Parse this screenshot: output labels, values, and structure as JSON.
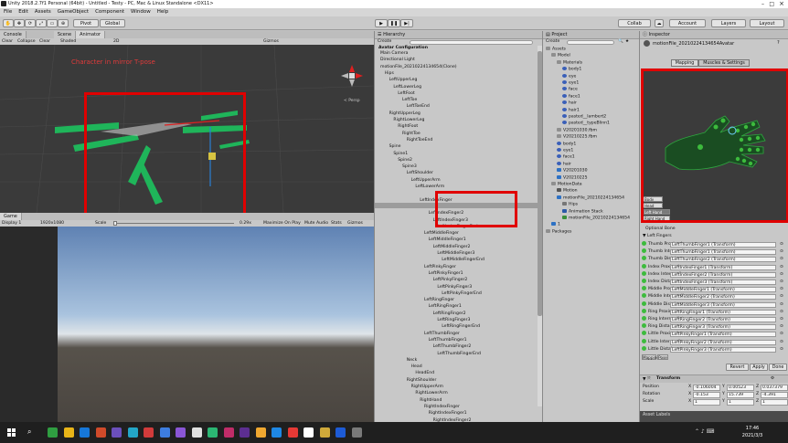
{
  "window": {
    "title": "Unity 2018.2.7f1 Personal (64bit) - Untitled - Testy - PC, Mac & Linux Standalone <DX11>"
  },
  "menu": [
    "File",
    "Edit",
    "Assets",
    "GameObject",
    "Component",
    "Window",
    "Help"
  ],
  "toolbar": {
    "pivot": "Pivot",
    "global": "Global",
    "collab": "Collab",
    "account": "Account",
    "layers": "Layers",
    "layout": "Layout"
  },
  "scene": {
    "tabs": [
      "Console",
      "Scene",
      "Animator"
    ],
    "row": [
      "Clear",
      "Collapse",
      "Clear",
      "Shaded",
      "2D",
      "Gizmos"
    ],
    "annotation": "Character in mirror T-pose",
    "persp": "< Persp"
  },
  "game": {
    "tab": "Game",
    "display": "Display 1",
    "resolution": "1920x1080",
    "scale_label": "Scale",
    "scale_value": "0.29x",
    "buttons": [
      "Maximize On Play",
      "Mute Audio",
      "Stats",
      "Gizmos"
    ]
  },
  "hierarchy": {
    "title": "Hierarchy",
    "create": "Create",
    "root": "Avatar Configuration",
    "items": [
      {
        "label": "Main Camera",
        "indent": 0
      },
      {
        "label": "Directional Light",
        "indent": 0
      },
      {
        "label": "motionFile_20210224134654(Clone)",
        "indent": 0
      },
      {
        "label": "Hips",
        "indent": 1
      },
      {
        "label": "LeftUpperLeg",
        "indent": 2
      },
      {
        "label": "LeftLowerLeg",
        "indent": 3
      },
      {
        "label": "LeftFoot",
        "indent": 4
      },
      {
        "label": "LeftToe",
        "indent": 5
      },
      {
        "label": "LeftToeEnd",
        "indent": 6
      },
      {
        "label": "RightUpperLeg",
        "indent": 2
      },
      {
        "label": "RightLowerLeg",
        "indent": 3
      },
      {
        "label": "RightFoot",
        "indent": 4
      },
      {
        "label": "RightToe",
        "indent": 5
      },
      {
        "label": "RightToeEnd",
        "indent": 6
      },
      {
        "label": "Spine",
        "indent": 2
      },
      {
        "label": "Spine1",
        "indent": 3
      },
      {
        "label": "Spine2",
        "indent": 4
      },
      {
        "label": "Spine3",
        "indent": 5
      },
      {
        "label": "LeftShoulder",
        "indent": 6
      },
      {
        "label": "LeftUpperArm",
        "indent": 7
      },
      {
        "label": "LeftLowerArm",
        "indent": 8
      },
      {
        "label": "",
        "indent": 0
      },
      {
        "label": "LeftIndexFinger",
        "indent": 9
      },
      {
        "label": "LeftIndexFinger1",
        "indent": 10
      },
      {
        "label": "LeftIndexFinger2",
        "indent": 11
      },
      {
        "label": "LeftIndexFinger3",
        "indent": 12
      },
      {
        "label": "LeftIndexFingerEnd",
        "indent": 13
      },
      {
        "label": "LeftMiddleFinger",
        "indent": 10
      },
      {
        "label": "LeftMiddleFinger1",
        "indent": 11
      },
      {
        "label": "LeftMiddleFinger2",
        "indent": 12
      },
      {
        "label": "LeftMiddleFinger3",
        "indent": 13
      },
      {
        "label": "LeftMiddleFingerEnd",
        "indent": 14
      },
      {
        "label": "LeftPinkyFinger",
        "indent": 10
      },
      {
        "label": "LeftPinkyFinger1",
        "indent": 11
      },
      {
        "label": "LeftPinkyFinger2",
        "indent": 12
      },
      {
        "label": "LeftPinkyFinger3",
        "indent": 13
      },
      {
        "label": "LeftPinkyFingerEnd",
        "indent": 14
      },
      {
        "label": "LeftRingFinger",
        "indent": 10
      },
      {
        "label": "LeftRingFinger1",
        "indent": 11
      },
      {
        "label": "LeftRingFinger2",
        "indent": 12
      },
      {
        "label": "LeftRingFinger3",
        "indent": 13
      },
      {
        "label": "LeftRingFingerEnd",
        "indent": 14
      },
      {
        "label": "LeftThumbFinger",
        "indent": 10
      },
      {
        "label": "LeftThumbFinger1",
        "indent": 11
      },
      {
        "label": "LeftThumbFinger2",
        "indent": 12
      },
      {
        "label": "LeftThumbFingerEnd",
        "indent": 13
      },
      {
        "label": "Neck",
        "indent": 6
      },
      {
        "label": "Head",
        "indent": 7
      },
      {
        "label": "HeadEnd",
        "indent": 8
      },
      {
        "label": "RightShoulder",
        "indent": 6
      },
      {
        "label": "RightUpperArm",
        "indent": 7
      },
      {
        "label": "RightLowerArm",
        "indent": 8
      },
      {
        "label": "RightHand",
        "indent": 9
      },
      {
        "label": "RightIndexFinger",
        "indent": 10
      },
      {
        "label": "RightIndexFinger1",
        "indent": 11
      },
      {
        "label": "RightIndexFinger2",
        "indent": 12
      }
    ]
  },
  "project": {
    "title": "Project",
    "create": "Create",
    "items": [
      {
        "label": "Assets",
        "indent": 0,
        "icon": "folder"
      },
      {
        "label": "Model",
        "indent": 1,
        "icon": "folder"
      },
      {
        "label": "Materials",
        "indent": 2,
        "icon": "folder"
      },
      {
        "label": "body1",
        "indent": 3,
        "icon": "sphere"
      },
      {
        "label": "eye",
        "indent": 3,
        "icon": "sphere"
      },
      {
        "label": "eye1",
        "indent": 3,
        "icon": "sphere"
      },
      {
        "label": "face",
        "indent": 3,
        "icon": "sphere"
      },
      {
        "label": "face1",
        "indent": 3,
        "icon": "sphere"
      },
      {
        "label": "hair",
        "indent": 3,
        "icon": "sphere"
      },
      {
        "label": "hair1",
        "indent": 3,
        "icon": "sphere"
      },
      {
        "label": "pasted__lambert2",
        "indent": 3,
        "icon": "sphere"
      },
      {
        "label": "pasted__typeBlinn1",
        "indent": 3,
        "icon": "sphere"
      },
      {
        "label": "V20201030.fbm",
        "indent": 2,
        "icon": "folder"
      },
      {
        "label": "V20210225.fbm",
        "indent": 2,
        "icon": "folder"
      },
      {
        "label": "body1",
        "indent": 2,
        "icon": "sphere"
      },
      {
        "label": "eye1",
        "indent": 2,
        "icon": "sphere"
      },
      {
        "label": "face1",
        "indent": 2,
        "icon": "sphere"
      },
      {
        "label": "hair",
        "indent": 2,
        "icon": "sphere"
      },
      {
        "label": "V20201030",
        "indent": 2,
        "icon": "model"
      },
      {
        "label": "V20210225",
        "indent": 2,
        "icon": "model"
      },
      {
        "label": "MotionData",
        "indent": 1,
        "icon": "folder"
      },
      {
        "label": "Motion",
        "indent": 2,
        "icon": "file"
      },
      {
        "label": "motionFile_20210224134654",
        "indent": 2,
        "icon": "model"
      },
      {
        "label": "Hips",
        "indent": 3,
        "icon": "bone"
      },
      {
        "label": "Animation Stack",
        "indent": 3,
        "icon": "anim"
      },
      {
        "label": "motionFile_20210224134654",
        "indent": 3,
        "icon": "avatar"
      },
      {
        "label": "1",
        "indent": 1,
        "icon": "model"
      },
      {
        "label": "Packages",
        "indent": 0,
        "icon": "folder"
      }
    ]
  },
  "inspector": {
    "title": "Inspector",
    "object_name": "motionFile_20210224134654Avatar",
    "tabs": [
      "Mapping",
      "Muscles & Settings"
    ],
    "bone_buttons": [
      "Body",
      "Head",
      "Left Hand",
      "Right Hand"
    ],
    "section": "Optional Bone",
    "group": "Left Fingers",
    "fingers": [
      {
        "name": "Thumb Proximal",
        "value": "LeftThumbFinger1 (Transform)"
      },
      {
        "name": "Thumb Intermedi",
        "value": "LeftThumbFinger1 (Transform)"
      },
      {
        "name": "Thumb Distal",
        "value": "LeftThumbFinger2 (Transform)"
      },
      {
        "name": "Index Proximal",
        "value": "LeftIndexFinger1 (Transform)"
      },
      {
        "name": "Index Intermedi",
        "value": "LeftIndexFinger2 (Transform)"
      },
      {
        "name": "Index Distal",
        "value": "LeftIndexFinger3 (Transform)"
      },
      {
        "name": "Middle Proximal",
        "value": "LeftMiddleFinger1 (Transform)"
      },
      {
        "name": "Middle Intermedi",
        "value": "LeftMiddleFinger2 (Transform)"
      },
      {
        "name": "Middle Distal",
        "value": "LeftMiddleFinger3 (Transform)"
      },
      {
        "name": "Ring Proximal",
        "value": "LeftRingFinger1 (Transform)"
      },
      {
        "name": "Ring Intermediat",
        "value": "LeftRingFinger2 (Transform)"
      },
      {
        "name": "Ring Distal",
        "value": "LeftRingFinger3 (Transform)"
      },
      {
        "name": "Little Proximal",
        "value": "LeftPinkyFinger1 (Transform)"
      },
      {
        "name": "Little Intermedi",
        "value": "LeftPinkyFinger2 (Transform)"
      },
      {
        "name": "Little Distal",
        "value": "LeftPinkyFinger3 (Transform)"
      }
    ],
    "map_tabs": [
      "Mapping",
      "Pose"
    ],
    "buttons": [
      "Revert",
      "Apply",
      "Done"
    ],
    "transform": {
      "title": "Transform",
      "position": {
        "label": "Position",
        "x": "-0.106004",
        "y": "0.00523",
        "z": "0.037379"
      },
      "rotation": {
        "label": "Rotation",
        "x": "-0.153",
        "y": "15.739",
        "z": "-4.391"
      },
      "scale": {
        "label": "Scale",
        "x": "1",
        "y": "1",
        "z": "1"
      }
    },
    "asset_labels": "Asset Labels"
  },
  "taskbar": {
    "time": "17:46",
    "date": "2021/3/3",
    "icons": [
      "#2f9e41",
      "#e8b418",
      "#1677d9",
      "#d04a2a",
      "#6b4fbb",
      "#23a6c7",
      "#d13b3b",
      "#3d7de0",
      "#8a56d6",
      "#e0e0e0",
      "#2bb673",
      "#c02c68",
      "#5c2e91",
      "#f0a830",
      "#1e88e5",
      "#e53935",
      "#ffffff",
      "#cfa93a",
      "#1d5bd6",
      "#7a7a7a"
    ],
    "accent": "#e00000"
  }
}
